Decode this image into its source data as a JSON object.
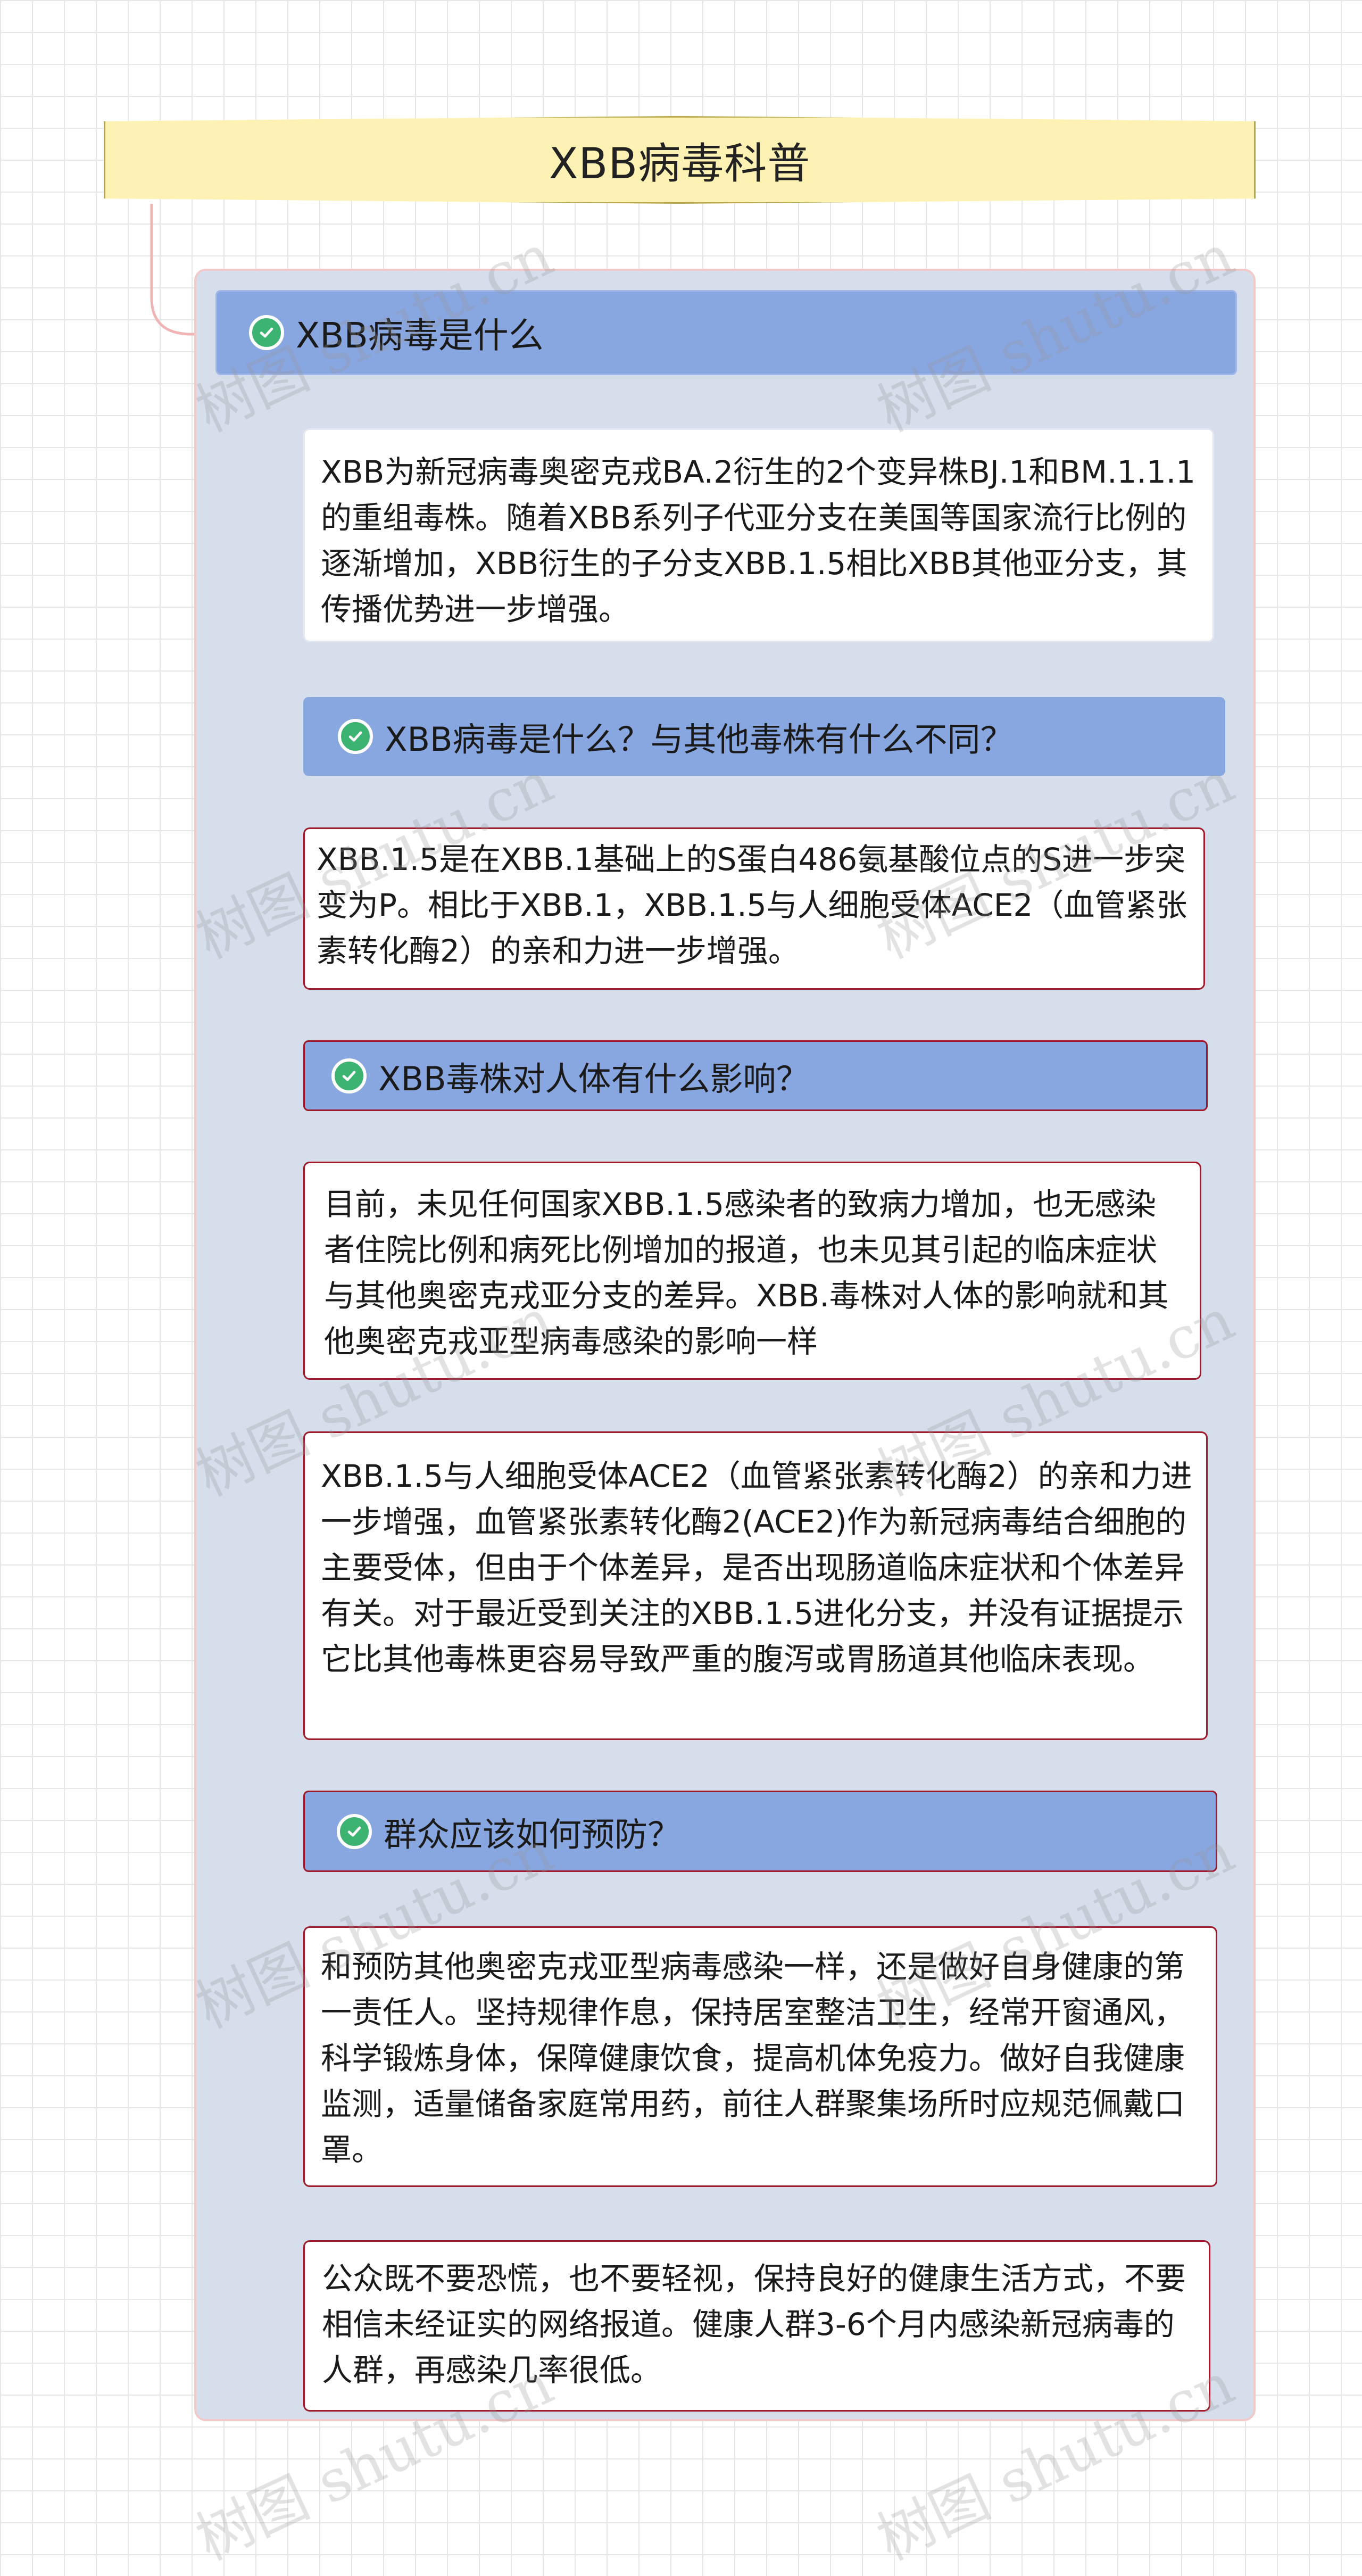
{
  "root": {
    "title": "XBB病毒科普"
  },
  "sections": [
    {
      "header": "XBB病毒是什么"
    },
    {
      "header": "XBB病毒是什么？与其他毒株有什么不同？"
    },
    {
      "header": "XBB毒株对人体有什么影响？"
    },
    {
      "header": "群众应该如何预防？"
    }
  ],
  "paragraphs": [
    "XBB为新冠病毒奥密克戎BA.2衍生的2个变异株BJ.1和BM.1.1.1的重组毒株。随着XBB系列子代亚分支在美国等国家流行比例的逐渐增加，XBB衍生的子分支XBB.1.5相比XBB其他亚分支，其传播优势进一步增强。",
    "XBB.1.5是在XBB.1基础上的S蛋白486氨基酸位点的S进一步突变为P。相比于XBB.1，XBB.1.5与人细胞受体ACE2（血管紧张素转化酶2）的亲和力进一步增强。",
    "目前，未见任何国家XBB.1.5感染者的致病力增加，也无感染者住院比例和病死比例增加的报道，也未见其引起的临床症状与其他奥密克戎亚分支的差异。XBB.毒株对人体的影响就和其他奥密克戎亚型病毒感染的影响一样",
    "XBB.1.5与人细胞受体ACE2（血管紧张素转化酶2）的亲和力进一步增强，血管紧张素转化酶2(ACE2)作为新冠病毒结合细胞的主要受体，但由于个体差异，是否出现肠道临床症状和个体差异有关。对于最近受到关注的XBB.1.5进化分支，并没有证据提示它比其他毒株更容易导致严重的腹泻或胃肠道其他临床表现。",
    "和预防其他奥密克戎亚型病毒感染一样，还是做好自身健康的第一责任人。坚持规律作息，保持居室整洁卫生，经常开窗通风，科学锻炼身体，保障健康饮食，提高机体免疫力。做好自我健康监测，适量储备家庭常用药，前往人群聚集场所时应规范佩戴口罩。",
    "公众既不要恐慌，也不要轻视，保持良好的健康生活方式，不要相信未经证实的网络报道。健康人群3-6个月内感染新冠病毒的人群，再感染几率很低。"
  ],
  "watermark": "树图 shutu.cn",
  "icons": {
    "check": "check-circle-icon"
  },
  "colors": {
    "root_fill": "#fdf1b3",
    "container_fill": "#d6deec",
    "header_fill": "#88a6df",
    "accent_border": "#a11a2b",
    "check_green": "#3cb371",
    "connector": "#f0b4b4"
  }
}
